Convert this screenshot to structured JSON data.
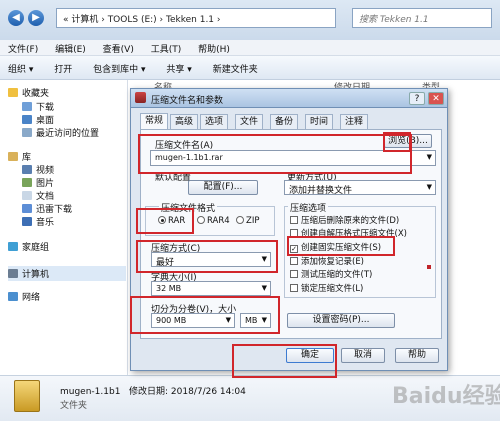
{
  "explorer": {
    "address_path": "« 计算机 › TOOLS (E:) › Tekken 1.1 ›",
    "search_placeholder": "搜索 Tekken 1.1",
    "menu": [
      "文件(F)",
      "编辑(E)",
      "查看(V)",
      "工具(T)",
      "帮助(H)"
    ],
    "toolbar": [
      "组织 ▾",
      "打开",
      "包含到库中 ▾",
      "共享 ▾",
      "新建文件夹"
    ],
    "columns": [
      "名称",
      "修改日期",
      "类型"
    ],
    "nav": {
      "favorites": "收藏夹",
      "downloads": "下载",
      "desktop": "桌面",
      "recent": "最近访问的位置",
      "libraries": "库",
      "videos": "视频",
      "pictures": "图片",
      "documents": "文档",
      "thunder": "迅雷下载",
      "music": "音乐",
      "homegroup": "家庭组",
      "computer": "计算机",
      "network": "网络"
    },
    "details": {
      "name": "mugen-1.1b1",
      "modified": "修改日期: 2018/7/26 14:04",
      "type": "文件夹"
    }
  },
  "dialog": {
    "title": "压缩文件名和参数",
    "tabs": [
      "常规",
      "高级",
      "选项",
      "文件",
      "备份",
      "时间",
      "注释"
    ],
    "archive_name_label": "压缩文件名(A)",
    "browse_button": "浏览(B)...",
    "archive_name_value": "mugen-1.1b1.rar",
    "default_profile_label": "默认配置",
    "profile_button": "配置(F)...",
    "update_mode_label": "更新方式(U)",
    "update_mode_value": "添加并替换文件",
    "format_label": "压缩文件格式",
    "formats": [
      "RAR",
      "RAR4",
      "ZIP"
    ],
    "selected_format": "RAR",
    "method_label": "压缩方式(C)",
    "method_value": "最好",
    "dict_label": "字典大小(I)",
    "dict_value": "32 MB",
    "split_label": "切分为分卷(V)，大小",
    "split_value": "900 MB",
    "split_unit": "MB",
    "options_label": "压缩选项",
    "options": [
      {
        "label": "压缩后删除原来的文件(D)",
        "checked": false
      },
      {
        "label": "创建自解压格式压缩文件(X)",
        "checked": false
      },
      {
        "label": "创建固实压缩文件(S)",
        "checked": true
      },
      {
        "label": "添加恢复记录(E)",
        "checked": false
      },
      {
        "label": "测试压缩的文件(T)",
        "checked": false
      },
      {
        "label": "锁定压缩文件(L)",
        "checked": false
      }
    ],
    "password_button": "设置密码(P)...",
    "ok_button": "确定",
    "cancel_button": "取消",
    "help_button": "帮助"
  },
  "watermark": "Baidu经验",
  "colors": {
    "highlight_red": "#d1262b",
    "folder_yellow": "#e8c14f"
  }
}
